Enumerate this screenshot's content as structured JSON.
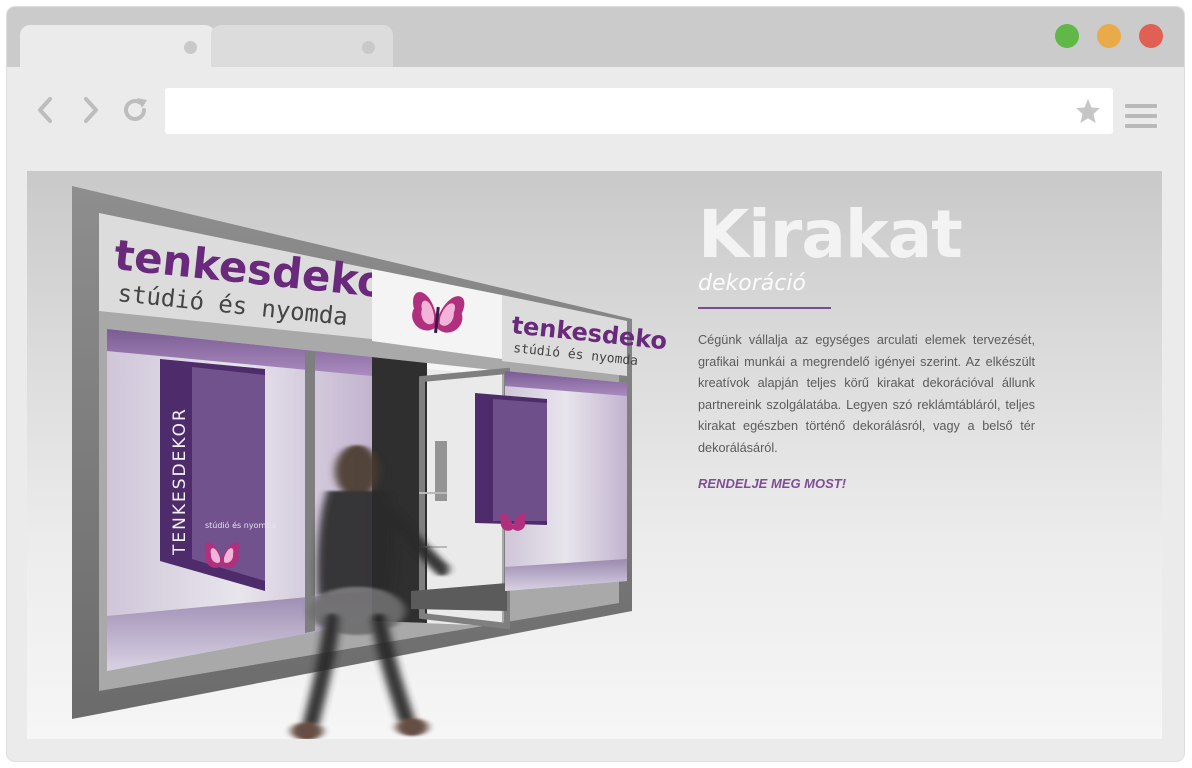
{
  "browser": {
    "tabs": [
      {
        "label": ""
      },
      {
        "label": ""
      }
    ],
    "address_bar": {
      "value": "",
      "placeholder": ""
    },
    "icons": {
      "back": "chevron-left-icon",
      "forward": "chevron-right-icon",
      "reload": "reload-icon",
      "bookmark": "star-icon",
      "menu": "hamburger-menu-icon"
    },
    "window_colors": {
      "green": "#5fb847",
      "yellow": "#e9aa4a",
      "red": "#e06054"
    }
  },
  "storefront": {
    "sign_left_brand": "tenkesdekor",
    "sign_left_tagline": "stúdió és nyomda",
    "sign_right_brand": "tenkesdekor",
    "sign_right_tagline": "stúdió és nyomda",
    "poster_vertical_text": "TENKESDEKOR",
    "poster_small_text": "stúdió és nyomda",
    "brand_color": "#6a2a7c",
    "accent_color": "#b0307e"
  },
  "hero": {
    "title": "Kirakat",
    "subtitle": "dekoráció",
    "paragraph": "Cégünk vállalja az egységes arculati elemek tervezését, grafikai munkái a megrendelő igényei szerint. Az elkészült kreatívok alapján teljes körű kirakat dekorációval állunk partnereink szolgálatába. Legyen szó reklámtábláról, teljes kirakat egészben történő dekorálásról, vagy a belső tér dekorálásáról.",
    "cta": "RENDELJE MEG MOST!",
    "accent_color": "#7d4f93"
  }
}
